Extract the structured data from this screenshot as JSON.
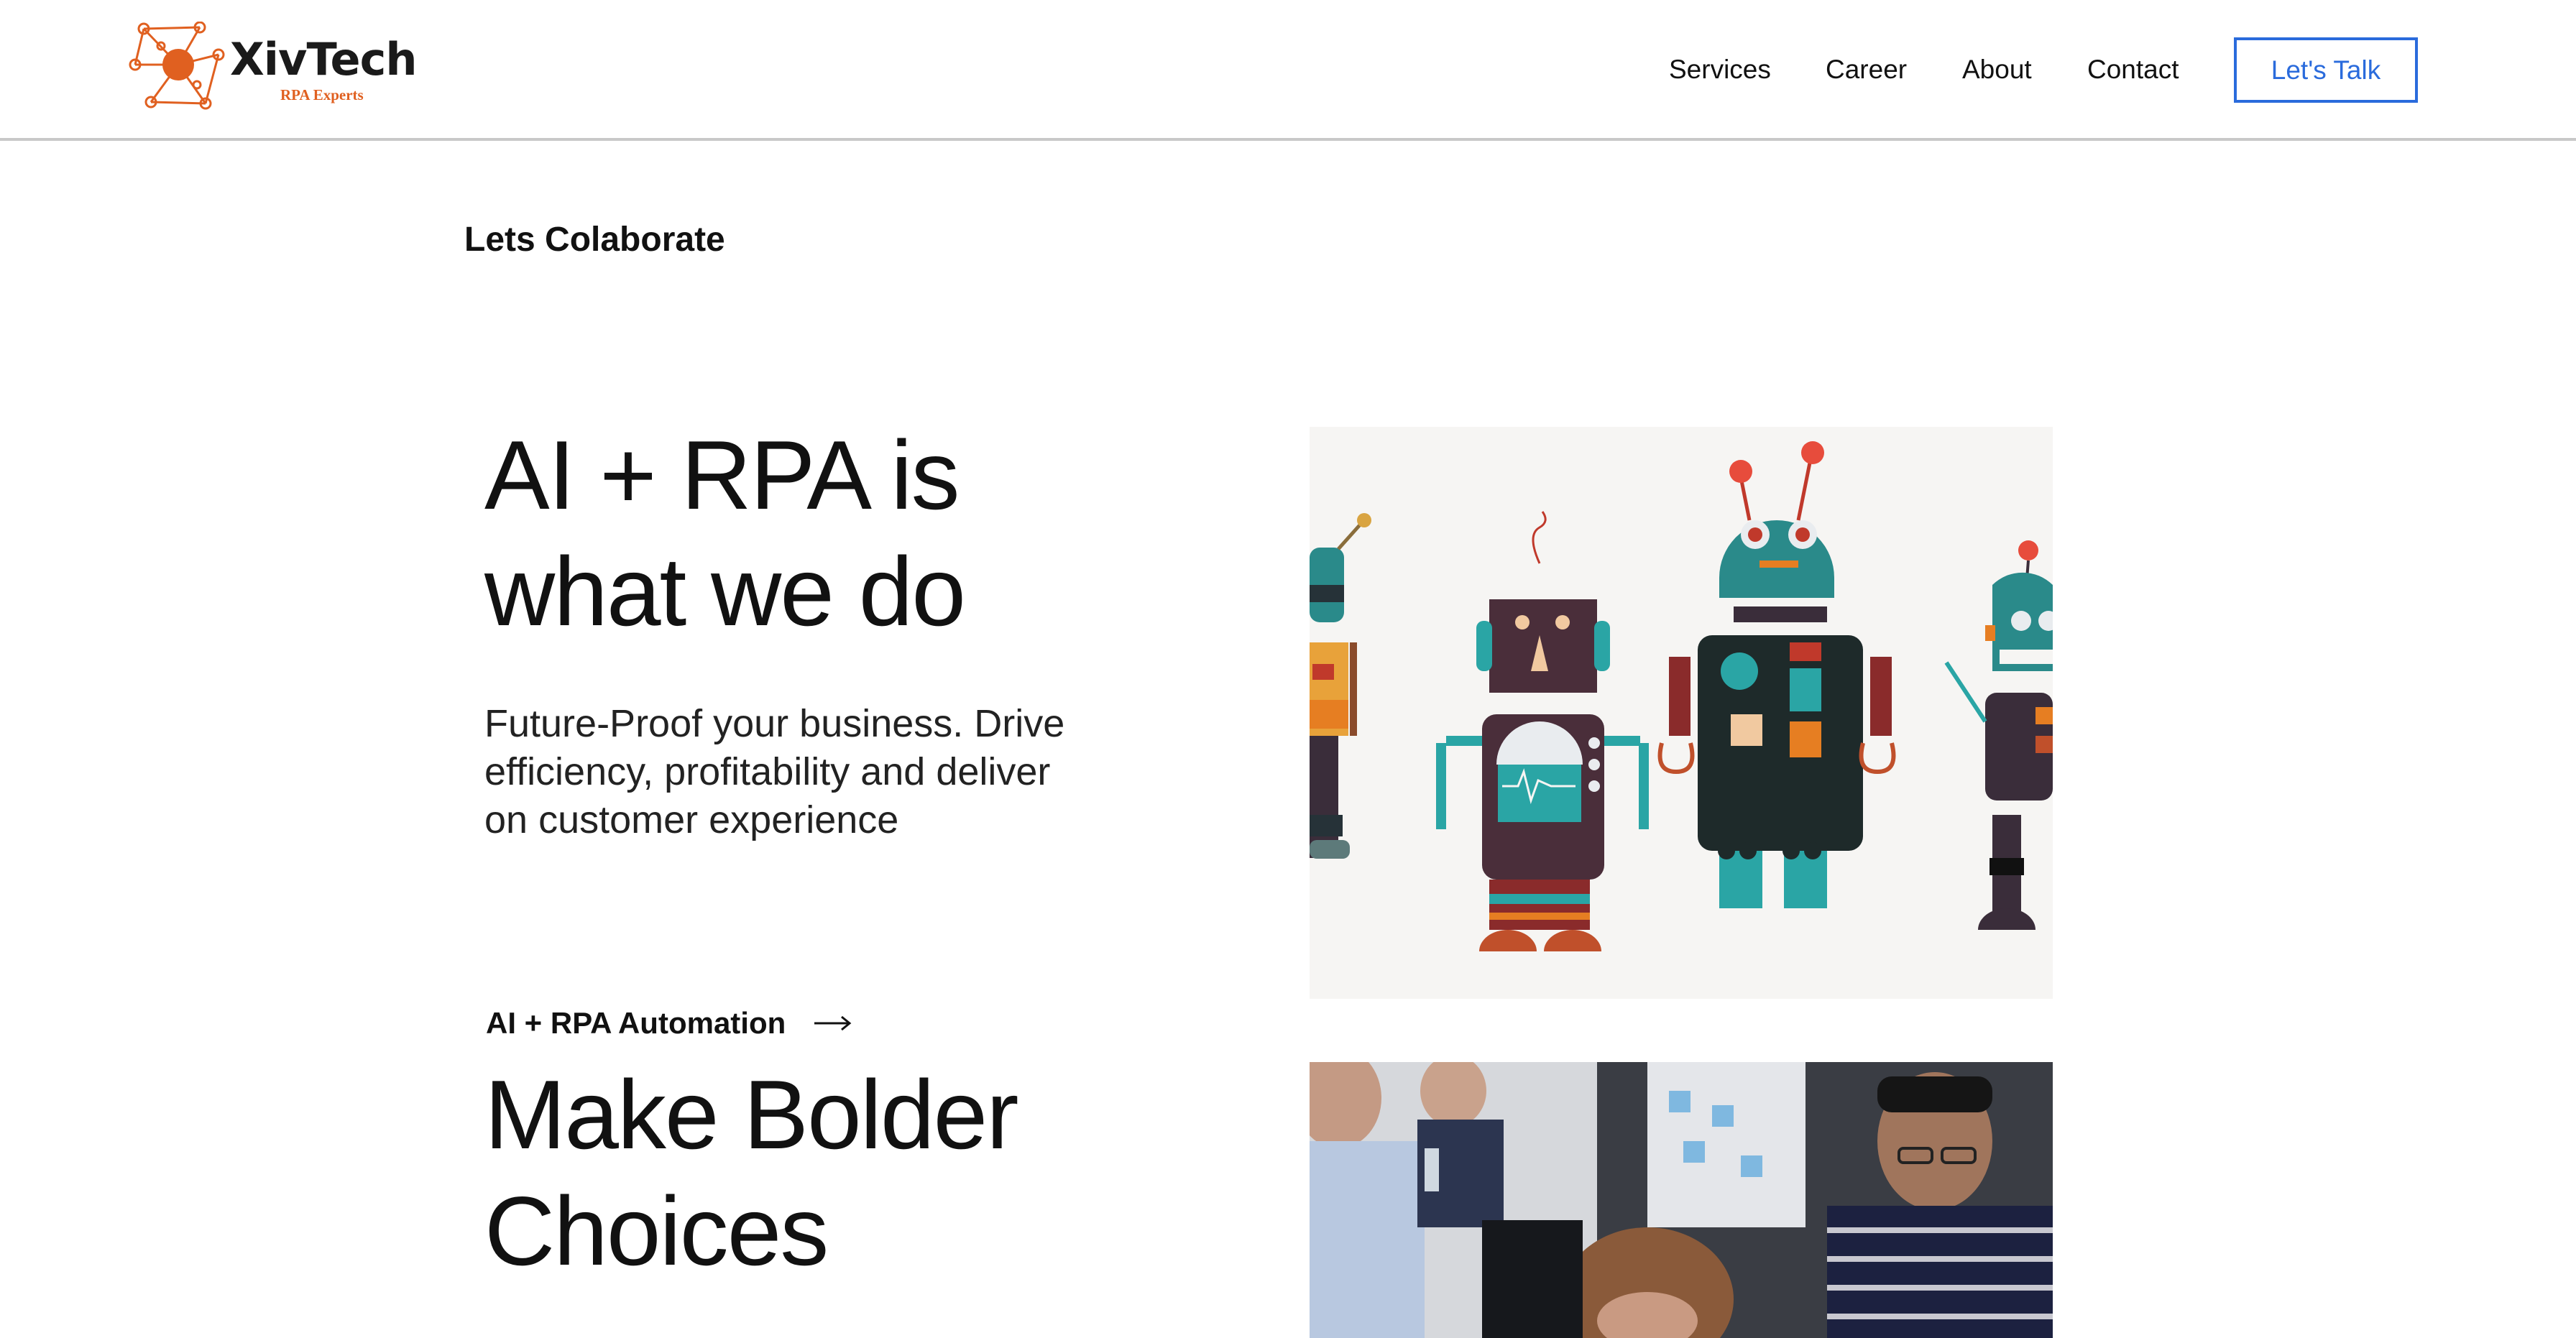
{
  "brand": {
    "name": "XivTech",
    "tagline": "RPA Experts",
    "accent": "#e06020"
  },
  "nav": {
    "items": [
      "Services",
      "Career",
      "About",
      "Contact"
    ],
    "cta_label": "Let's Talk",
    "cta_color": "#2a6bdc"
  },
  "hero": {
    "section_label": "Lets Colaborate",
    "title_line1": "AI + RPA is",
    "title_line2": "what we do",
    "subtitle_line1": "Future-Proof your business. Drive",
    "subtitle_line2": "efficiency, profitability and deliver",
    "subtitle_line3": "on customer experience"
  },
  "feature": {
    "link_label": "AI + RPA Automation",
    "title_line1": "Make Bolder",
    "title_line2": "Choices"
  },
  "images": {
    "robots_alt": "robots-illustration",
    "people_alt": "team-photo"
  }
}
